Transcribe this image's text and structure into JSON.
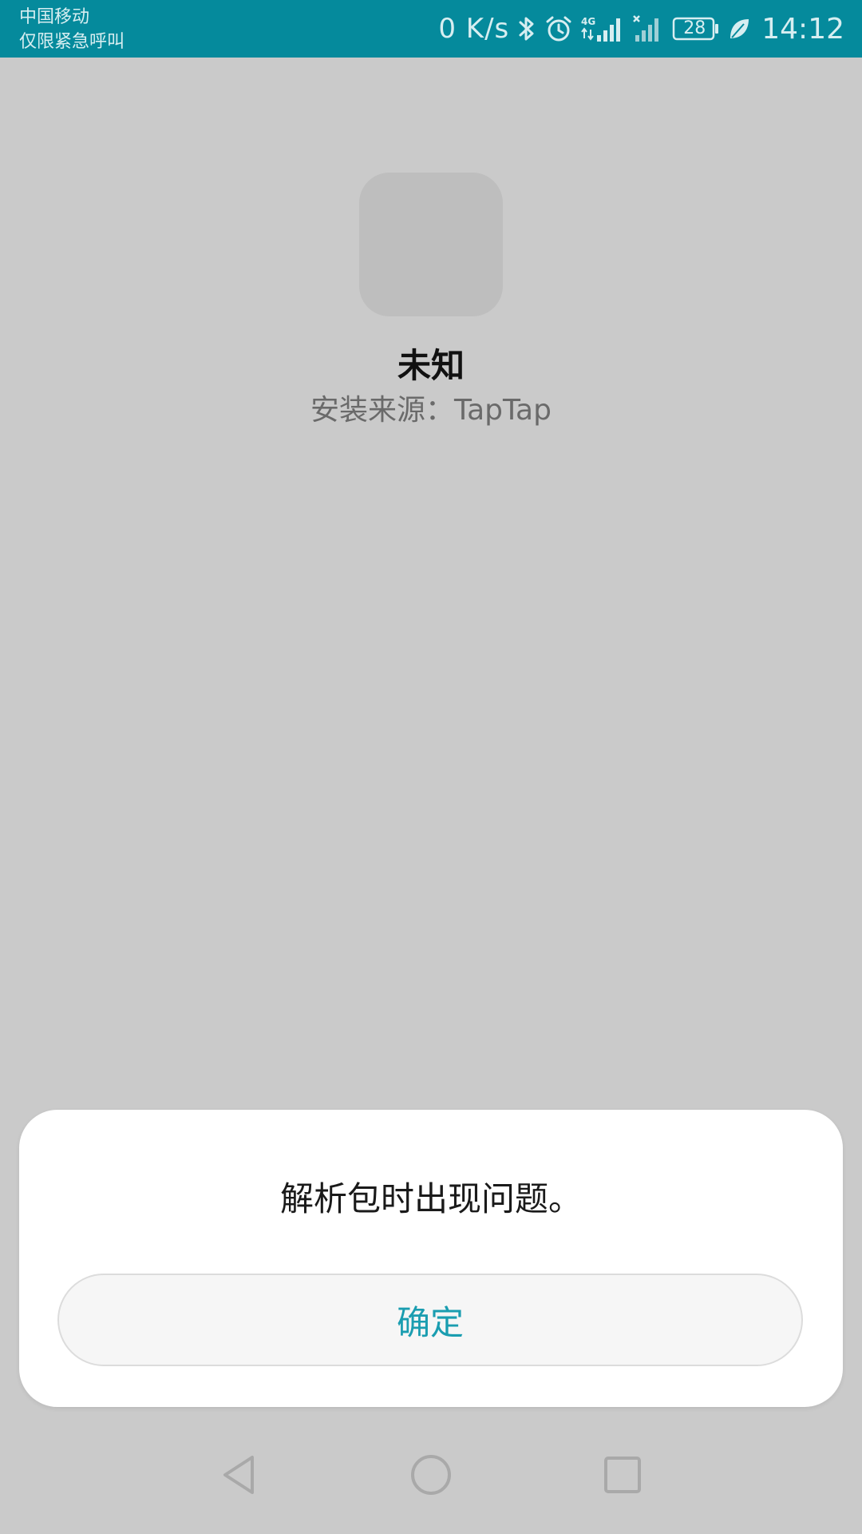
{
  "status_bar": {
    "carrier_line1": "中国移动",
    "carrier_line2": "仅限紧急呼叫",
    "net_speed": "0 K/s",
    "battery_level": "28",
    "time": "14:12",
    "icons": [
      "bluetooth-icon",
      "alarm-icon",
      "signal-4g-icon",
      "signal-nosim-icon",
      "battery-icon",
      "leaf-icon"
    ]
  },
  "app": {
    "name": "未知",
    "install_source": "安装来源：TapTap"
  },
  "dialog": {
    "message": "解析包时出现问题。",
    "confirm_label": "确定"
  },
  "nav_bar": {
    "icons": [
      "back-icon",
      "home-icon",
      "recents-icon"
    ]
  },
  "colors": {
    "status_bar_bg": "#058a9c",
    "background": "#cacaca",
    "accent": "#1a9db0",
    "dialog_bg": "#ffffff"
  }
}
